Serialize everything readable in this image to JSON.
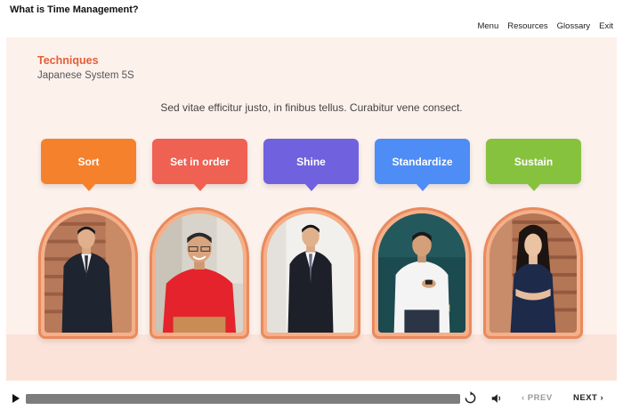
{
  "course": {
    "title": "What is Time Management?"
  },
  "nav": {
    "items": [
      "Menu",
      "Resources",
      "Glossary",
      "Exit"
    ]
  },
  "slide": {
    "section_title": "Techniques",
    "section_subtitle": "Japanese System 5S",
    "intro": "Sed vitae efficitur justo, in finibus tellus. Curabitur vene consect."
  },
  "steps": [
    {
      "label": "Sort",
      "color": "#f5812c",
      "portrait": "man in dark suit leaning on wood wall"
    },
    {
      "label": "Set in order",
      "color": "#ef6153",
      "portrait": "smiling man in red t-shirt"
    },
    {
      "label": "Shine",
      "color": "#7062df",
      "portrait": "young man in dark suit"
    },
    {
      "label": "Standardize",
      "color": "#4e8df5",
      "portrait": "man in white shirt using phone"
    },
    {
      "label": "Sustain",
      "color": "#87c23f",
      "portrait": "woman in navy dress arms crossed"
    }
  ],
  "player": {
    "prev_label": "‹ PREV",
    "next_label": "NEXT ›",
    "progress": 1.0
  }
}
